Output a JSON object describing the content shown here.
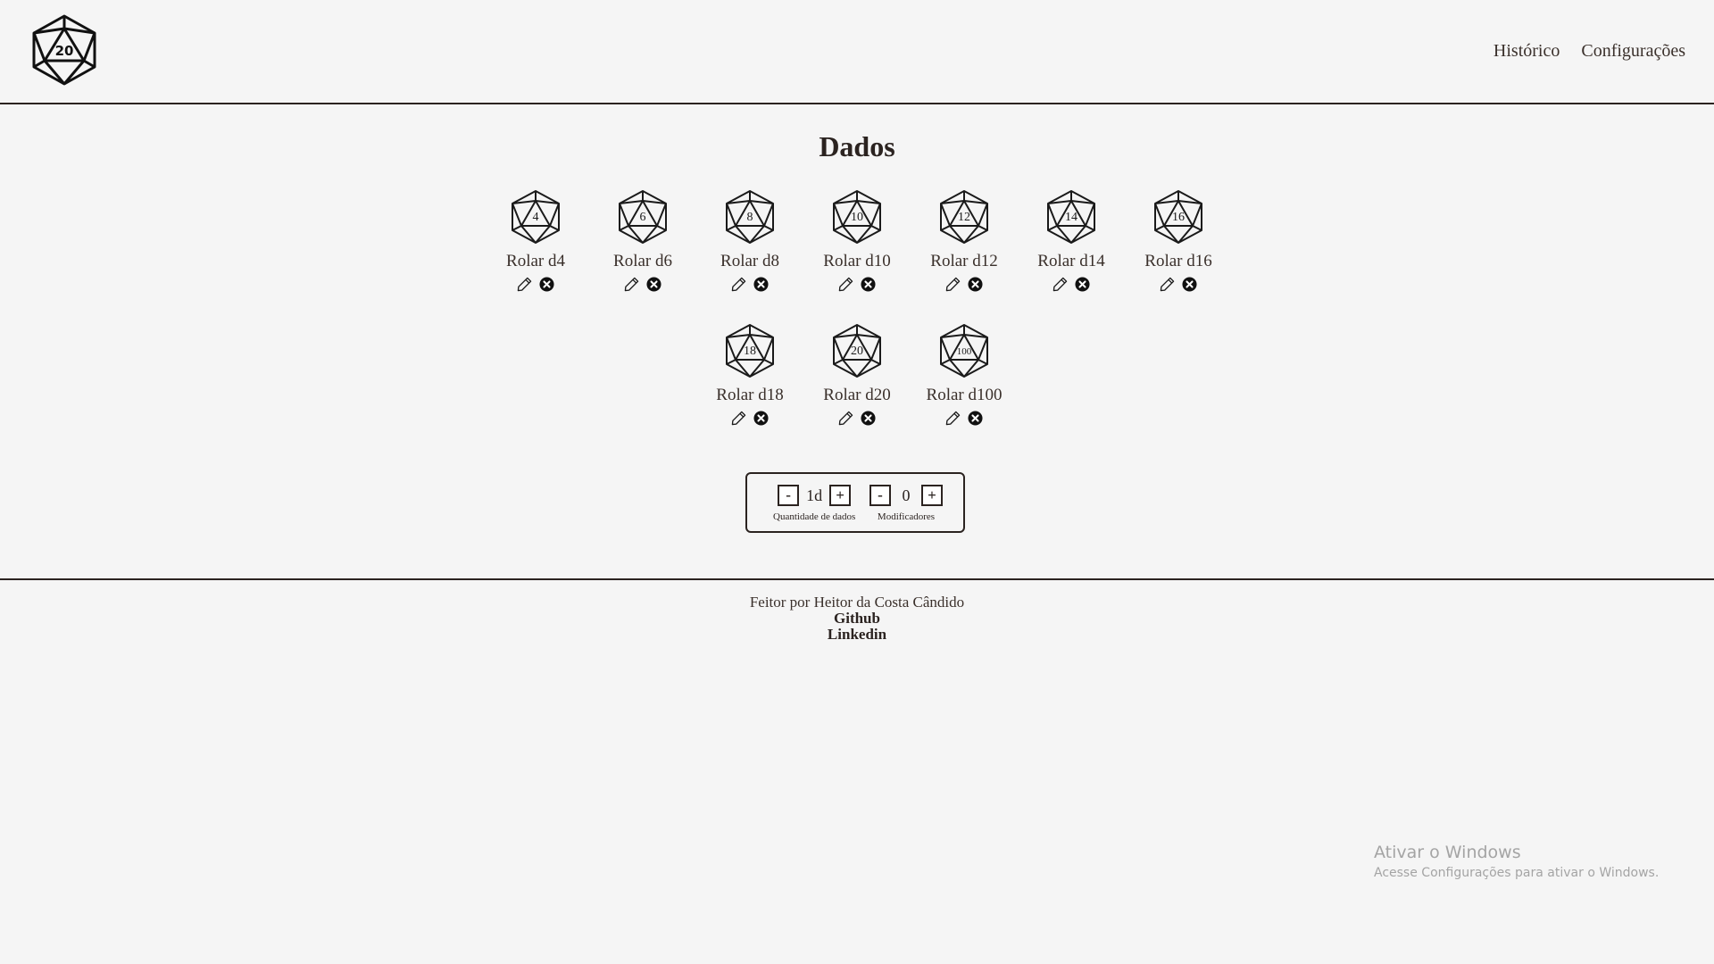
{
  "header": {
    "logo_number": "20",
    "nav": [
      "Histórico",
      "Configurações"
    ]
  },
  "page_title": "Dados",
  "dice": [
    {
      "number": "4",
      "label": "Rolar d4"
    },
    {
      "number": "6",
      "label": "Rolar d6"
    },
    {
      "number": "8",
      "label": "Rolar d8"
    },
    {
      "number": "10",
      "label": "Rolar d10"
    },
    {
      "number": "12",
      "label": "Rolar d12"
    },
    {
      "number": "14",
      "label": "Rolar d14"
    },
    {
      "number": "16",
      "label": "Rolar d16"
    },
    {
      "number": "18",
      "label": "Rolar d18"
    },
    {
      "number": "20",
      "label": "Rolar d20"
    },
    {
      "number": "100",
      "label": "Rolar d100"
    }
  ],
  "controls": {
    "quantity": {
      "minus": "-",
      "value": "1d",
      "plus": "+",
      "caption": "Quantidade de dados"
    },
    "modifier": {
      "minus": "-",
      "value": "0",
      "plus": "+",
      "caption": "Modificadores"
    }
  },
  "footer": {
    "credit": "Feitor por Heitor da Costa Cândido",
    "links": [
      "Github",
      "Linkedin"
    ]
  },
  "watermark": {
    "title": "Ativar o Windows",
    "subtitle": "Acesse Configurações para ativar o Windows."
  }
}
